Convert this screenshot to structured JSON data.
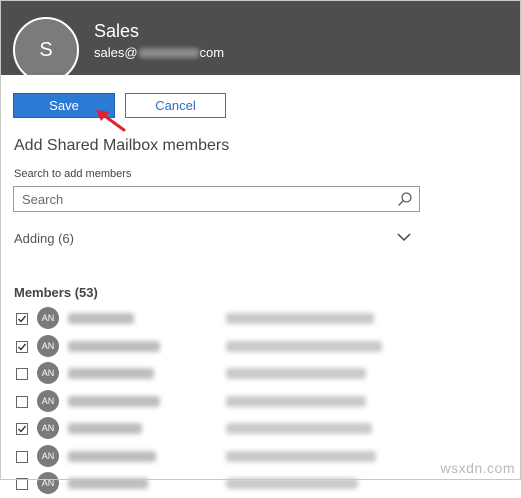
{
  "header": {
    "avatar_initial": "S",
    "name": "Sales",
    "email_prefix": "sales@",
    "email_suffix": "com"
  },
  "buttons": {
    "save_label": "Save",
    "cancel_label": "Cancel"
  },
  "section_title": "Add Shared Mailbox members",
  "search": {
    "label": "Search to add members",
    "placeholder": "Search"
  },
  "adding": "Adding (6)",
  "members": {
    "title": "Members (53)",
    "rows": [
      {
        "initials": "AN",
        "checked": true
      },
      {
        "initials": "AN",
        "checked": true
      },
      {
        "initials": "AN",
        "checked": false
      },
      {
        "initials": "AN",
        "checked": false
      },
      {
        "initials": "AN",
        "checked": true
      },
      {
        "initials": "AN",
        "checked": false
      },
      {
        "initials": "AN",
        "checked": false
      }
    ]
  },
  "watermark": "wsxdn.com",
  "colors": {
    "header_bg": "#4e4e4e",
    "accent": "#2b7ad3",
    "annotation_arrow": "#e0202a"
  },
  "icons": [
    "search-icon",
    "chevron-down-icon",
    "checkbox-check-icon",
    "annotation-arrow-icon"
  ]
}
